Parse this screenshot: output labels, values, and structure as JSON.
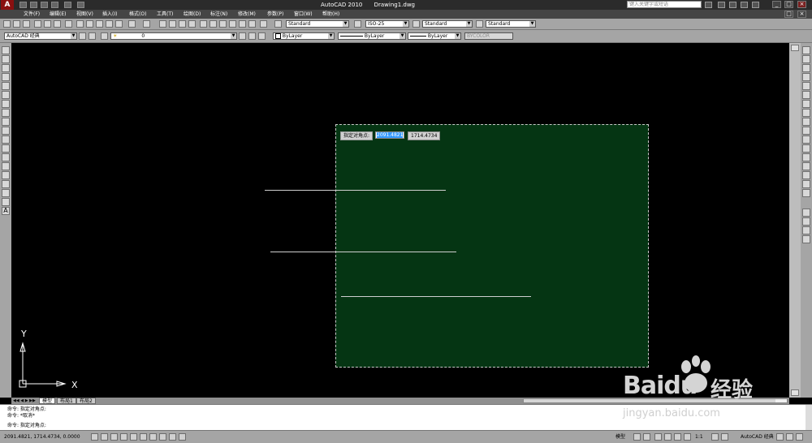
{
  "titlebar": {
    "app": "AutoCAD 2010",
    "file": "Drawing1.dwg",
    "search_placeholder": "键入关键字或短语"
  },
  "menu": [
    "文件(F)",
    "编辑(E)",
    "视图(V)",
    "插入(I)",
    "格式(O)",
    "工具(T)",
    "绘图(D)",
    "标注(N)",
    "修改(M)",
    "参数(P)",
    "窗口(W)",
    "帮助(H)"
  ],
  "toolbar_styles": {
    "text_style": "Standard",
    "dim_style": "ISO-25",
    "table_style": "Standard",
    "multileader_style": "Standard"
  },
  "toolbar_layers": {
    "workspace": "AutoCAD 经典",
    "layer": "0",
    "color": "ByLayer",
    "linetype": "ByLayer",
    "lineweight": "ByLayer",
    "plotstyle": "BYCOLOR"
  },
  "tooltip": {
    "prompt": "指定对角点:",
    "x_value": "2091.4821",
    "y_value": "1714.4734"
  },
  "ucs": {
    "x": "X",
    "y": "Y"
  },
  "tabs": [
    "模型",
    "布局1",
    "布局2"
  ],
  "command": {
    "lines": [
      "命令: 指定对角点:",
      "命令: *取消*",
      "命令: 指定对角点:"
    ]
  },
  "status": {
    "coords": "2091.4821,  1714.4734,  0.0000",
    "model": "模型",
    "scale": "1:1",
    "workspace": "AutoCAD 经典"
  },
  "watermark": {
    "brand": "Baidu",
    "cn": "经验",
    "url": "jingyan.baidu.com"
  }
}
